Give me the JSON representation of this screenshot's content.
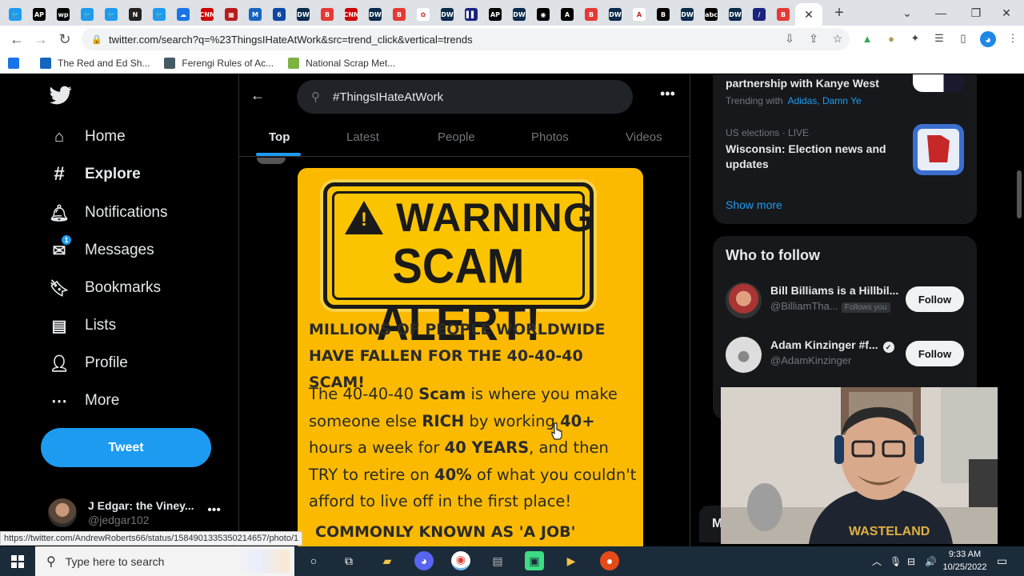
{
  "browser": {
    "url": "twitter.com/search?q=%23ThingsIHateAtWork&src=trend_click&vertical=trends",
    "tabs": [
      {
        "icon": "twitter-icon",
        "color": "#1d9bf0",
        "glyph": "🐦"
      },
      {
        "icon": "ap-icon",
        "color": "#000000",
        "glyph": "AP"
      },
      {
        "icon": "wapo-icon",
        "color": "#000000",
        "glyph": "wp"
      },
      {
        "icon": "twitter-icon",
        "color": "#1d9bf0",
        "glyph": "🐦"
      },
      {
        "icon": "twitter-icon",
        "color": "#1d9bf0",
        "glyph": "🐦"
      },
      {
        "icon": "news-icon",
        "color": "#222222",
        "glyph": "N"
      },
      {
        "icon": "twitter-icon",
        "color": "#1d9bf0",
        "glyph": "🐦"
      },
      {
        "icon": "cloud-icon",
        "color": "#1a73e8",
        "glyph": "☁"
      },
      {
        "icon": "cnn-icon",
        "color": "#cc0000",
        "glyph": "CNN"
      },
      {
        "icon": "newspaper-icon",
        "color": "#b71c1c",
        "glyph": "▦"
      },
      {
        "icon": "m-icon",
        "color": "#1565c0",
        "glyph": "M"
      },
      {
        "icon": "six-icon",
        "color": "#0d47a1",
        "glyph": "6"
      },
      {
        "icon": "dw-icon",
        "color": "#0a2a4a",
        "glyph": "DW"
      },
      {
        "icon": "b-icon",
        "color": "#e53935",
        "glyph": "B"
      },
      {
        "icon": "cnn-icon",
        "color": "#cc0000",
        "glyph": "CNN"
      },
      {
        "icon": "dw-icon",
        "color": "#0a2a4a",
        "glyph": "DW"
      },
      {
        "icon": "b-icon",
        "color": "#e53935",
        "glyph": "B"
      },
      {
        "icon": "nbc-icon",
        "color": "#ffffff",
        "glyph": "✿"
      },
      {
        "icon": "dw-icon",
        "color": "#0a2a4a",
        "glyph": "DW"
      },
      {
        "icon": "bars-icon",
        "color": "#1a237e",
        "glyph": "▌▌"
      },
      {
        "icon": "ap-icon",
        "color": "#000000",
        "glyph": "AP"
      },
      {
        "icon": "dw-icon",
        "color": "#0a2a4a",
        "glyph": "DW"
      },
      {
        "icon": "cbs-icon",
        "color": "#000000",
        "glyph": "◉"
      },
      {
        "icon": "a-icon",
        "color": "#000000",
        "glyph": "A"
      },
      {
        "icon": "b-icon",
        "color": "#e53935",
        "glyph": "B"
      },
      {
        "icon": "dw-icon",
        "color": "#0a2a4a",
        "glyph": "DW"
      },
      {
        "icon": "atlantic-icon",
        "color": "#ffffff",
        "glyph": "A"
      },
      {
        "icon": "bold-b-icon",
        "color": "#000000",
        "glyph": "B"
      },
      {
        "icon": "dw-icon",
        "color": "#0a2a4a",
        "glyph": "DW"
      },
      {
        "icon": "abc-icon",
        "color": "#000000",
        "glyph": "abc"
      },
      {
        "icon": "dw-icon",
        "color": "#0a2a4a",
        "glyph": "DW"
      },
      {
        "icon": "slash-icon",
        "color": "#1a237e",
        "glyph": "/"
      },
      {
        "icon": "b-icon",
        "color": "#e53935",
        "glyph": "B"
      }
    ],
    "bookmarks": [
      {
        "label": "The Red and Ed Sh...",
        "color": "#1565c0"
      },
      {
        "label": "Ferengi Rules of Ac...",
        "color": "#455a64"
      },
      {
        "label": "National Scrap Met...",
        "color": "#7cb342"
      }
    ]
  },
  "sidebar": {
    "items": [
      {
        "label": "Home",
        "icon": "home-icon",
        "bold": false
      },
      {
        "label": "Explore",
        "icon": "hashtag-icon",
        "bold": true
      },
      {
        "label": "Notifications",
        "icon": "bell-icon",
        "bold": false
      },
      {
        "label": "Messages",
        "icon": "mail-icon",
        "bold": false,
        "badge": "1"
      },
      {
        "label": "Bookmarks",
        "icon": "bookmark-icon",
        "bold": false
      },
      {
        "label": "Lists",
        "icon": "list-icon",
        "bold": false
      },
      {
        "label": "Profile",
        "icon": "person-icon",
        "bold": false
      },
      {
        "label": "More",
        "icon": "more-circle-icon",
        "bold": false
      }
    ],
    "tweet_label": "Tweet",
    "account": {
      "name": "J Edgar: the Viney...",
      "handle": "@jedgar102"
    }
  },
  "search": {
    "query": "#ThingsIHateAtWork",
    "tabs": [
      "Top",
      "Latest",
      "People",
      "Photos",
      "Videos"
    ],
    "active_tab": "Top"
  },
  "image": {
    "warning": "WARNING",
    "alert": "SCAM ALERT!",
    "headline": "MILLIONS OF PEOPLE WORLDWIDE HAVE FALLEN FOR THE 40-40-40 SCAM!",
    "body": {
      "p1": "The 40-40-40 ",
      "b1": "Scam",
      "p2": " is where you make someone else ",
      "b2": "RICH",
      "p3": " by working ",
      "b3": "40+",
      "p4": " hours a week for ",
      "b4": "40 YEARS",
      "p5": ", and then TRY to retire on ",
      "b5": "40%",
      "p6": " of what you couldn't afford to live off in the first place!"
    },
    "footer": "COMMONLY KNOWN AS  'A JOB'"
  },
  "trends": [
    {
      "title": "partnership with Kanye West",
      "meta_prefix": "Trending with",
      "meta_links": "Adidas, Damn Ye"
    },
    {
      "category": "US elections · LIVE",
      "title": "Wisconsin: Election news and updates"
    }
  ],
  "show_more": "Show more",
  "who_to_follow": {
    "title": "Who to follow",
    "users": [
      {
        "name": "Bill Billiams is a Hillbil...",
        "handle": "@BilliamTha...",
        "follows_you": "Follows you",
        "button": "Follow",
        "verified": false
      },
      {
        "name": "Adam Kinzinger #f...",
        "handle": "@AdamKinzinger",
        "button": "Follow",
        "verified": true
      }
    ]
  },
  "messages_drawer_peek": "M",
  "status_url": "https://twitter.com/AndrewRoberts66/status/1584901335350214657/photo/1",
  "taskbar": {
    "search_placeholder": "Type here to search",
    "time": "9:33 AM",
    "date": "10/25/2022"
  }
}
